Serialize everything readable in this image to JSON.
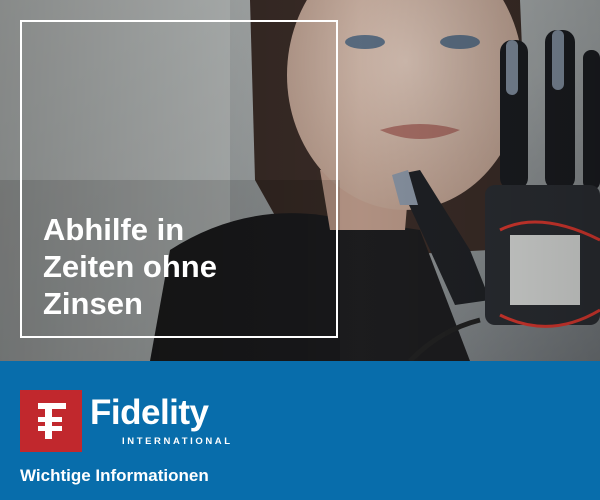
{
  "ad": {
    "headline": {
      "lines": [
        "Abhilfe in",
        "Zeiten ohne",
        "Zinsen"
      ]
    },
    "hero_image": {
      "description_icon": "woman-with-robotic-hand-photo"
    },
    "brand": {
      "logo_icon": "fidelity-f-icon",
      "name": "Fidelity",
      "subline": "INTERNATIONAL"
    },
    "info_link": {
      "label": "Wichtige Informationen"
    },
    "colors": {
      "footer_blue": "#086dab",
      "logo_red": "#c1282d",
      "text_white": "#ffffff"
    }
  }
}
